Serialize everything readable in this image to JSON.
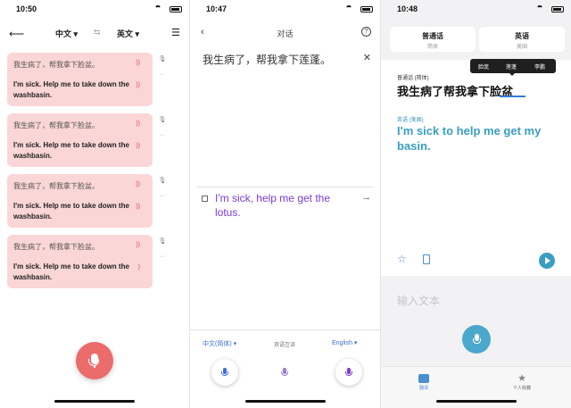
{
  "panel1": {
    "time": "10:50",
    "source_lang": "中文",
    "target_lang": "英文",
    "swap": "⇆",
    "messages": [
      {
        "zh": "我生病了，帮我拿下脸盆。",
        "en": "I'm sick. Help me to take down the washbasin."
      },
      {
        "zh": "我生病了，帮我拿下脸盆。",
        "en": "I'm sick. Help me to take down the washbasin."
      },
      {
        "zh": "我生病了，帮我拿下脸盆。",
        "en": "I'm sick. Help me to take down the washbasin."
      },
      {
        "zh": "我生病了，帮我拿下脸盆。",
        "en": "I'm sick. Help me to take down the washbasin."
      }
    ]
  },
  "panel2": {
    "time": "10:47",
    "title": "对话",
    "source_text": "我生病了，帮我拿下莲蓬。",
    "translation": "I'm sick, help me get the lotus.",
    "left_lang": "中文(简体)",
    "mode_label": "双语互译",
    "right_lang": "English"
  },
  "panel3": {
    "time": "10:48",
    "tab_source": {
      "name": "普通话",
      "sub": "简体"
    },
    "tab_target": {
      "name": "英语",
      "sub": "美国"
    },
    "popup_options": [
      "脸庞",
      "莲蓬",
      "李鹏"
    ],
    "source_label": "普通话 (简体)",
    "source_text": "我生病了帮我拿下脸盆",
    "target_label": "英语 (美国)",
    "translation": "I'm sick to help me get my basin.",
    "input_placeholder": "输入文本",
    "nav": {
      "translate": "翻译",
      "favorites": "个人收藏"
    }
  },
  "colors": {
    "card_pink": "#fbd6d6",
    "mic_red": "#ec6b6b",
    "purple_text": "#7b3bd4",
    "lang_blue": "#3a6fd8",
    "teal_text": "#3a9ec2"
  }
}
